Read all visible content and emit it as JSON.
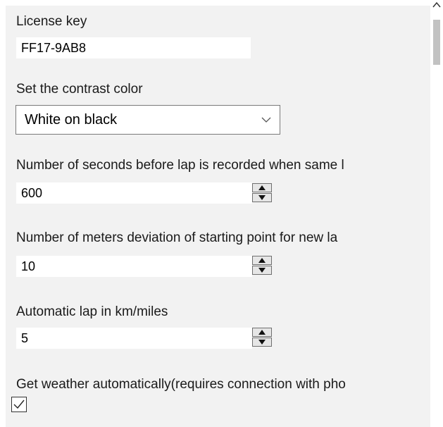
{
  "settings": {
    "license": {
      "label": "License key",
      "value": "FF17-9AB8"
    },
    "contrast": {
      "label": "Set the contrast color",
      "selected": "White on black"
    },
    "seconds_before_lap": {
      "label": "Number of seconds before lap is recorded when same l",
      "value": "600"
    },
    "meters_deviation": {
      "label": "Number of meters deviation of starting point for new la",
      "value": "10"
    },
    "auto_lap": {
      "label": "Automatic lap in km/miles",
      "value": "5"
    },
    "weather": {
      "label": "Get weather automatically(requires connection with pho",
      "checked": true
    }
  },
  "icons": {
    "dropdown": "chevron-down-icon",
    "spin_up": "triangle-up-icon",
    "spin_down": "triangle-down-icon",
    "check": "checkmark-icon",
    "scroll_up": "scroll-up-arrow-icon"
  },
  "colors": {
    "panel_background": "#f2f2f2",
    "input_background": "#ffffff",
    "text": "#1a1a1a",
    "scroll_thumb": "#c2c2c2"
  }
}
